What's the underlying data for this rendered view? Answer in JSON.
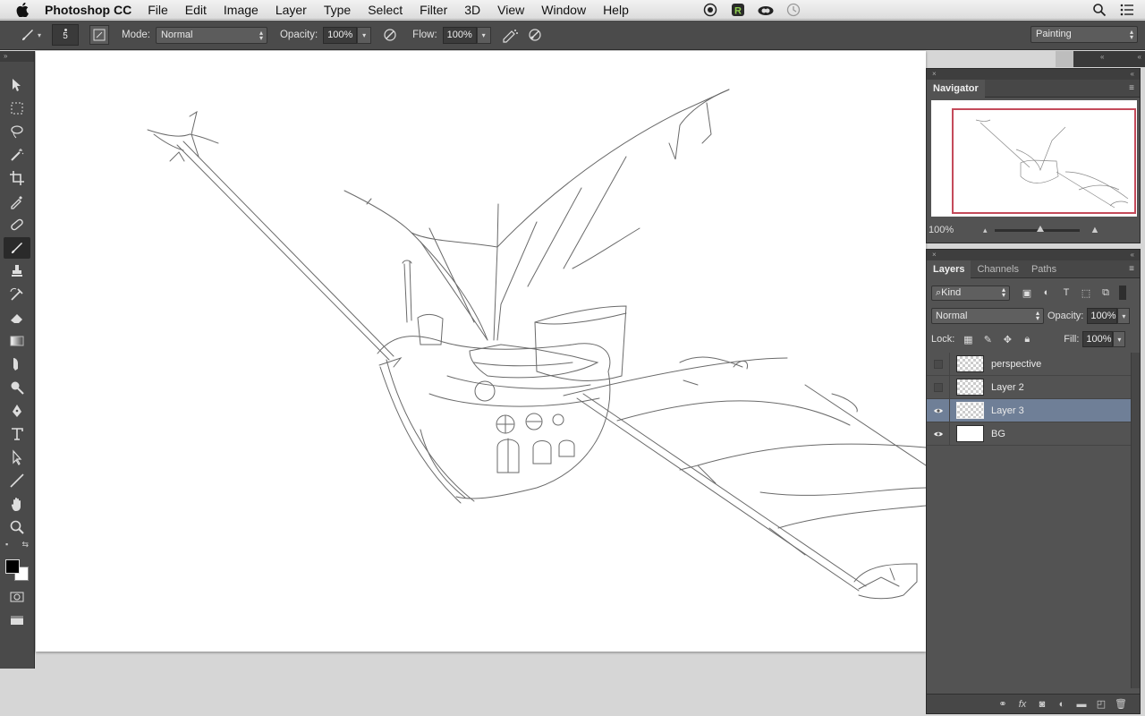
{
  "menubar": {
    "app_name": "Photoshop CC",
    "items": [
      "File",
      "Edit",
      "Image",
      "Layer",
      "Type",
      "Select",
      "Filter",
      "3D",
      "View",
      "Window",
      "Help"
    ]
  },
  "options": {
    "brush_size": "5",
    "mode_label": "Mode:",
    "mode_value": "Normal",
    "opacity_label": "Opacity:",
    "opacity_value": "100%",
    "flow_label": "Flow:",
    "flow_value": "100%",
    "workspace": "Painting"
  },
  "navigator": {
    "title": "Navigator",
    "zoom": "100%",
    "frame_color": "#c44a5a"
  },
  "layers_panel": {
    "tabs": [
      "Layers",
      "Channels",
      "Paths"
    ],
    "filter_kind": "Kind",
    "blend_mode": "Normal",
    "opacity_label": "Opacity:",
    "opacity_value": "100%",
    "lock_label": "Lock:",
    "fill_label": "Fill:",
    "fill_value": "100%",
    "layers": [
      {
        "name": "perspective",
        "visible": false,
        "selected": false
      },
      {
        "name": "Layer 2",
        "visible": false,
        "selected": false
      },
      {
        "name": "Layer 3",
        "visible": true,
        "selected": true
      },
      {
        "name": "BG",
        "visible": true,
        "selected": false
      }
    ]
  },
  "colors": {
    "foreground": "#000000",
    "background": "#ffffff",
    "selection": "#6f7f97"
  }
}
